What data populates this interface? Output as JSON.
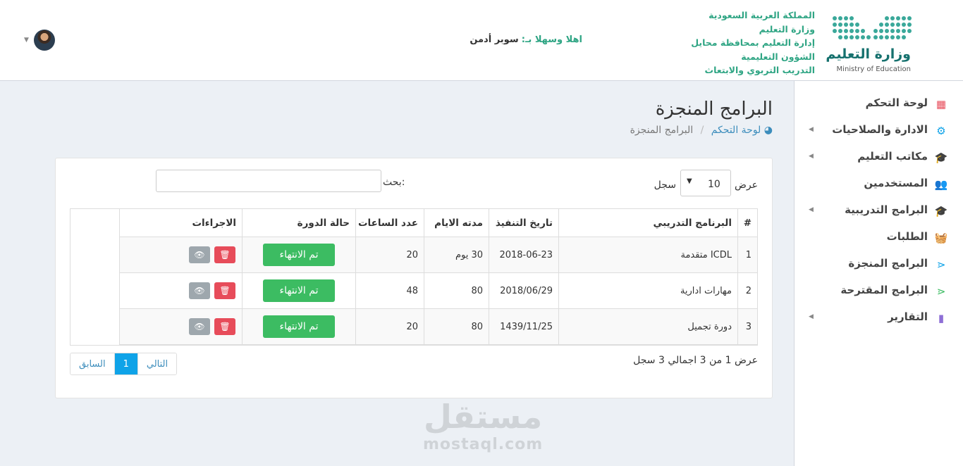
{
  "header": {
    "logo": {
      "arabic": "وزارة التعليم",
      "english": "Ministry of Education"
    },
    "org_lines": [
      "المملكة العربية السعودية",
      "وزارة التعليم",
      "إدارة التعليم بمحافظة محايل",
      "الشؤون التعليمية",
      "التدريب التربوي والابتعاث"
    ],
    "welcome_prefix": "اهلا وسهلا بـ:",
    "user_name": "سوبر أدمن",
    "colors": {
      "accent": "#2fa584",
      "logo_teal": "#16716e"
    }
  },
  "sidebar": {
    "items": [
      {
        "label": "لوحة التحكم",
        "icon": "dashboard-icon",
        "glyph": "▦",
        "color": "#e74c5a",
        "has_caret": false
      },
      {
        "label": "الادارة والصلاحيات",
        "icon": "gear-icon",
        "glyph": "⚙",
        "color": "#0fa3e8",
        "has_caret": true
      },
      {
        "label": "مكاتب التعليم",
        "icon": "graduation-cap-icon",
        "glyph": "🎓",
        "color": "#3cbc62",
        "has_caret": true
      },
      {
        "label": "المستخدمين",
        "icon": "users-icon",
        "glyph": "👥",
        "color": "#8e6fd6",
        "has_caret": false
      },
      {
        "label": "البرامج التدريبية",
        "icon": "graduation-cap-icon",
        "glyph": "🎓",
        "color": "#f0a830",
        "has_caret": true
      },
      {
        "label": "الطلبات",
        "icon": "basket-icon",
        "glyph": "🧺",
        "color": "#e74c5a",
        "has_caret": false
      },
      {
        "label": "البرامج المنجزة",
        "icon": "share-icon",
        "glyph": "⋖",
        "color": "#0fa3e8",
        "has_caret": false
      },
      {
        "label": "البرامج المقترحة",
        "icon": "share-icon",
        "glyph": "⋖",
        "color": "#3cbc62",
        "has_caret": false
      },
      {
        "label": "التقارير",
        "icon": "bar-chart-icon",
        "glyph": "▮",
        "color": "#8e6fd6",
        "has_caret": true
      }
    ]
  },
  "page": {
    "title": "البرامج المنجزة",
    "breadcrumb": {
      "home": "لوحة التحكم",
      "current": "البرامج المنجزة"
    }
  },
  "table_controls": {
    "show_label": "عرض",
    "page_length": "10",
    "records_label": "سجل",
    "search_label": "بحث:",
    "search_value": ""
  },
  "table": {
    "headers": [
      "#",
      "البرنامج التدريبي",
      "تاريخ التنفيذ",
      "مدته الايام",
      "عدد الساعات",
      "حالة الدورة",
      "الاجراءات"
    ],
    "rows": [
      {
        "num": "1",
        "program": "ICDL متقدمة",
        "date": "2018-06-23",
        "days": "30 يوم",
        "hours": "20",
        "status": "تم الانتهاء"
      },
      {
        "num": "2",
        "program": "مهارات ادارية",
        "date": "2018/06/29",
        "days": "80",
        "hours": "48",
        "status": "تم الانتهاء"
      },
      {
        "num": "3",
        "program": "دورة تجميل",
        "date": "1439/11/25",
        "days": "80",
        "hours": "20",
        "status": "تم الانتهاء"
      }
    ],
    "actions": {
      "delete_icon": "trash-icon",
      "view_icon": "eye-icon"
    },
    "colors": {
      "status": "#3cbc62",
      "delete": "#e74c5a",
      "view": "#9ea7ad"
    }
  },
  "footer": {
    "info": "عرض 1 من 3 اجمالي 3 سجل",
    "pagination": {
      "prev": "السابق",
      "current": "1",
      "next": "التالي"
    }
  },
  "watermark": {
    "arabic": "مستقل",
    "english": "mostaql.com"
  }
}
